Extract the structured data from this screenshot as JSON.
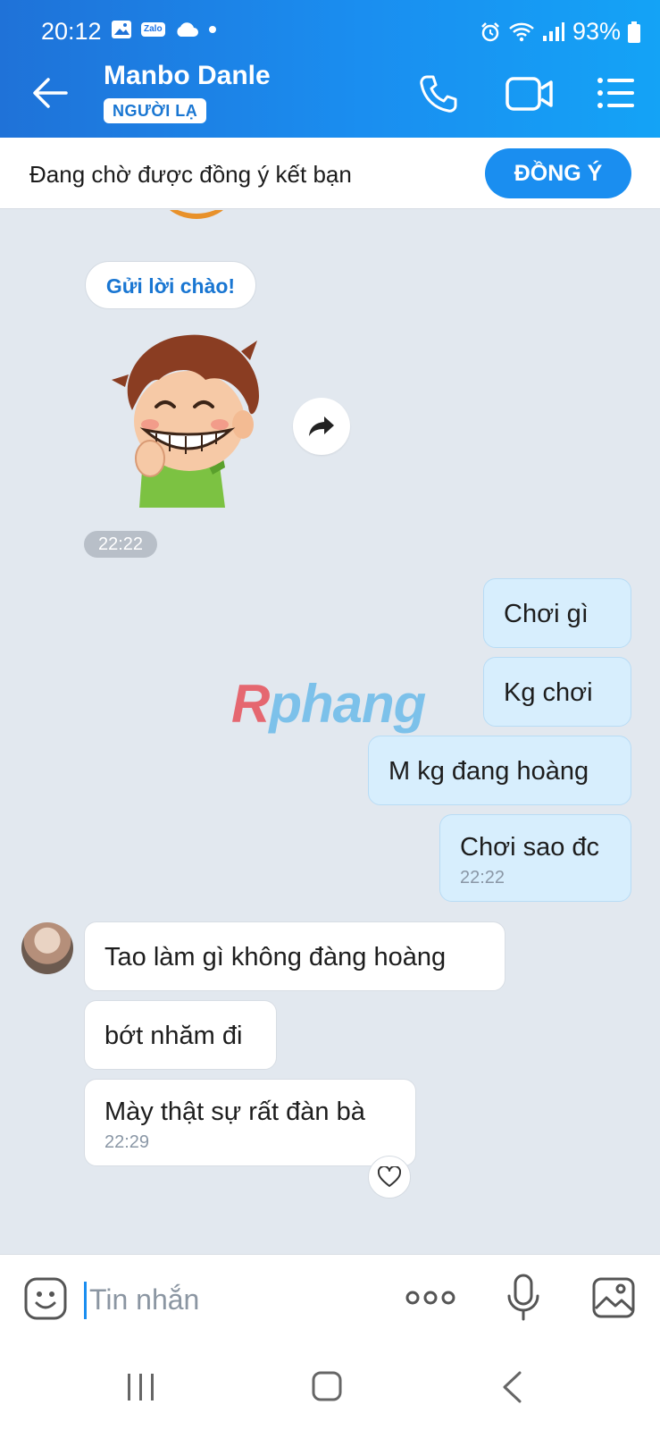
{
  "status_bar": {
    "time": "20:12",
    "zalo_label": "Zalo",
    "battery": "93%"
  },
  "header": {
    "contact_name": "Manbo Danle",
    "badge": "NGƯỜI LẠ"
  },
  "friend_request": {
    "text": "Đang chờ được đồng ý kết bạn",
    "accept_label": "ĐỒNG Ý"
  },
  "chat": {
    "greet_button": "Gửi lời chào!",
    "sticker_time": "22:22",
    "watermark": {
      "r": "R",
      "rest": "phang"
    },
    "outgoing": [
      {
        "text": "Chơi gì"
      },
      {
        "text": "Kg chơi"
      },
      {
        "text": "M kg đang hoàng"
      },
      {
        "text": "Chơi sao đc",
        "time": "22:22"
      }
    ],
    "incoming": [
      {
        "text": "Tao làm gì không đàng hoàng"
      },
      {
        "text": "bớt nhăm đi"
      },
      {
        "text": "Mày thật sự rất đàn bà",
        "time": "22:29"
      }
    ]
  },
  "input": {
    "placeholder": "Tin nhắn"
  },
  "colors": {
    "brand_blue": "#1a8ef0",
    "outgoing_bubble": "#d7eefd",
    "chat_background": "#e2e8ef"
  }
}
